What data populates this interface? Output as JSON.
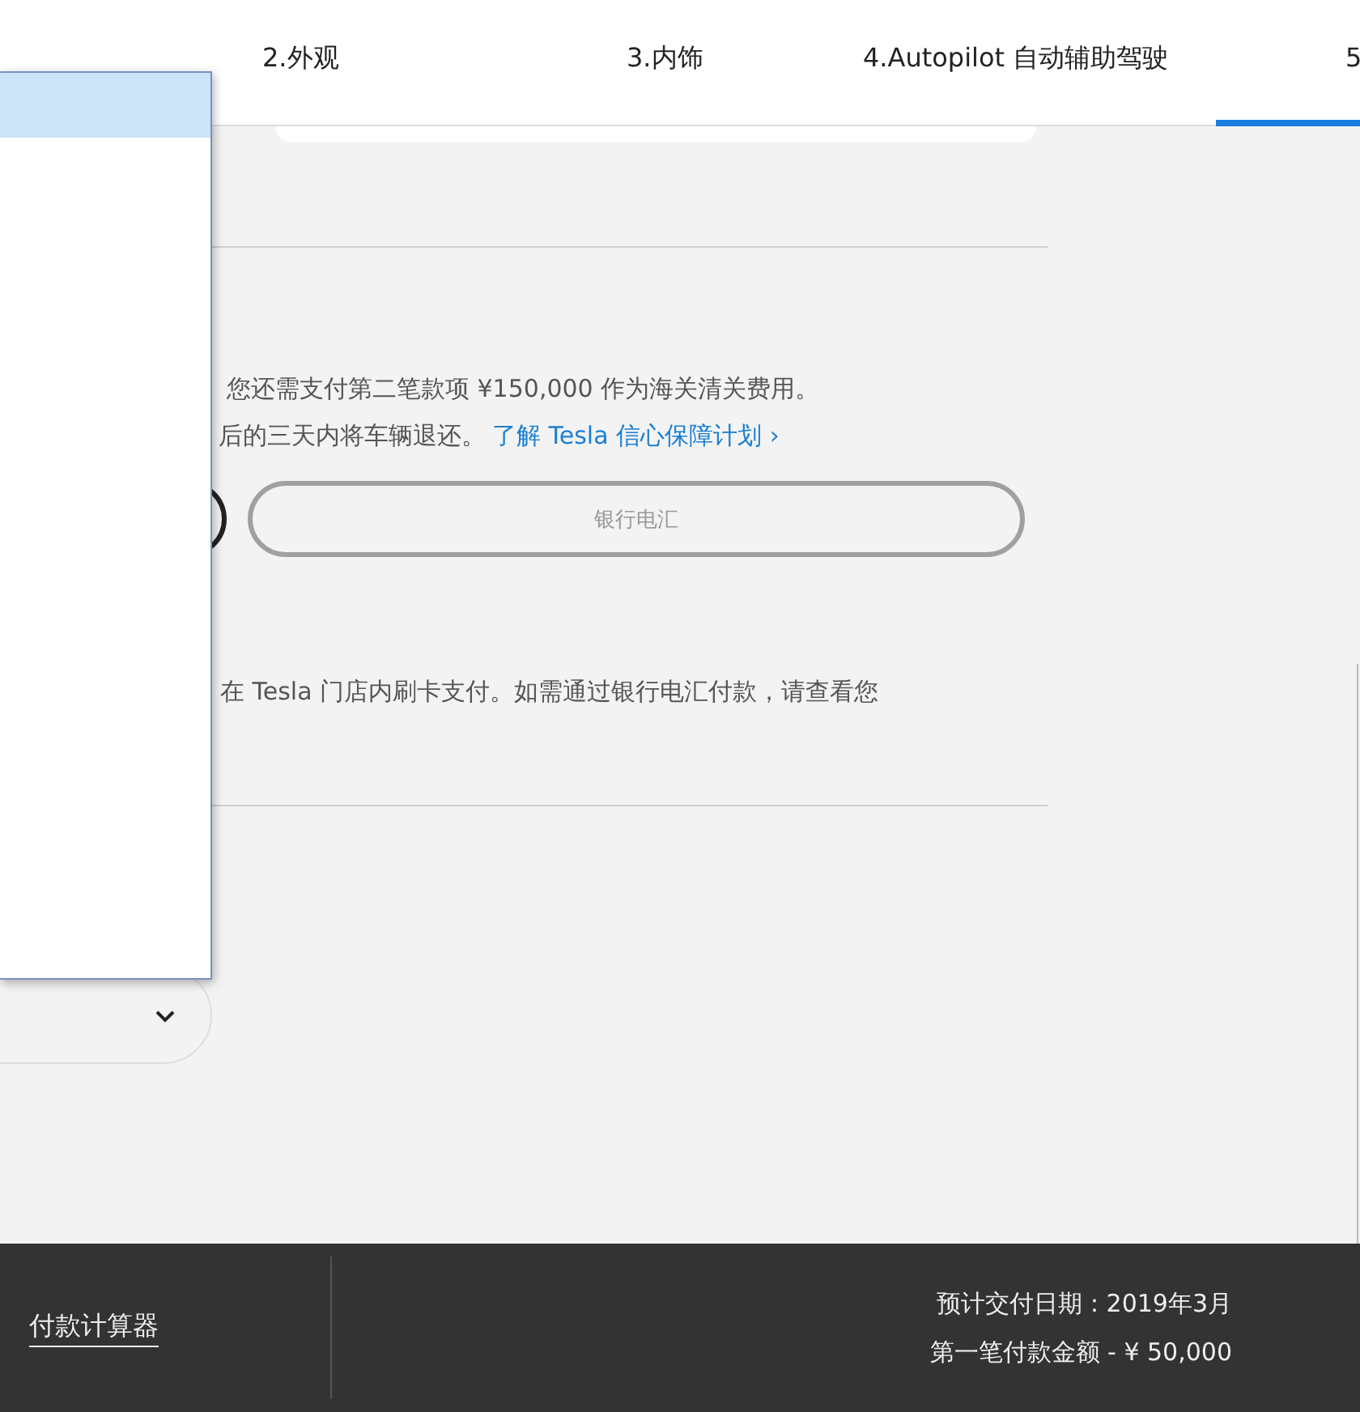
{
  "tabs": [
    {
      "label": "2.外观",
      "selected": false
    },
    {
      "label": "3.内饰",
      "selected": false
    },
    {
      "label": "4.Autopilot 自动辅助驾驶",
      "selected": false
    },
    {
      "label": "5",
      "selected": true
    }
  ],
  "dropdown_list": {
    "items": [
      {
        "selected": true
      }
    ]
  },
  "payment": {
    "notice": "您还需支付第二笔款项 ¥150,000 作为海关清关费用。",
    "return_text": "后的三天内将车辆退还。",
    "return_link": "了解 Tesla 信心保障计划 ›",
    "options": [
      {
        "selected": true
      },
      {
        "label": "银行电汇",
        "selected": false
      }
    ],
    "card_note": "在 Tesla 门店内刷卡支付。如需通过银行电汇付款，请查看您"
  },
  "footer": {
    "calculator_link": "付款计算器",
    "delivery_date": "预计交付日期：2019年3月",
    "first_payment": "第一笔付款金额 - ¥ 50,000"
  }
}
